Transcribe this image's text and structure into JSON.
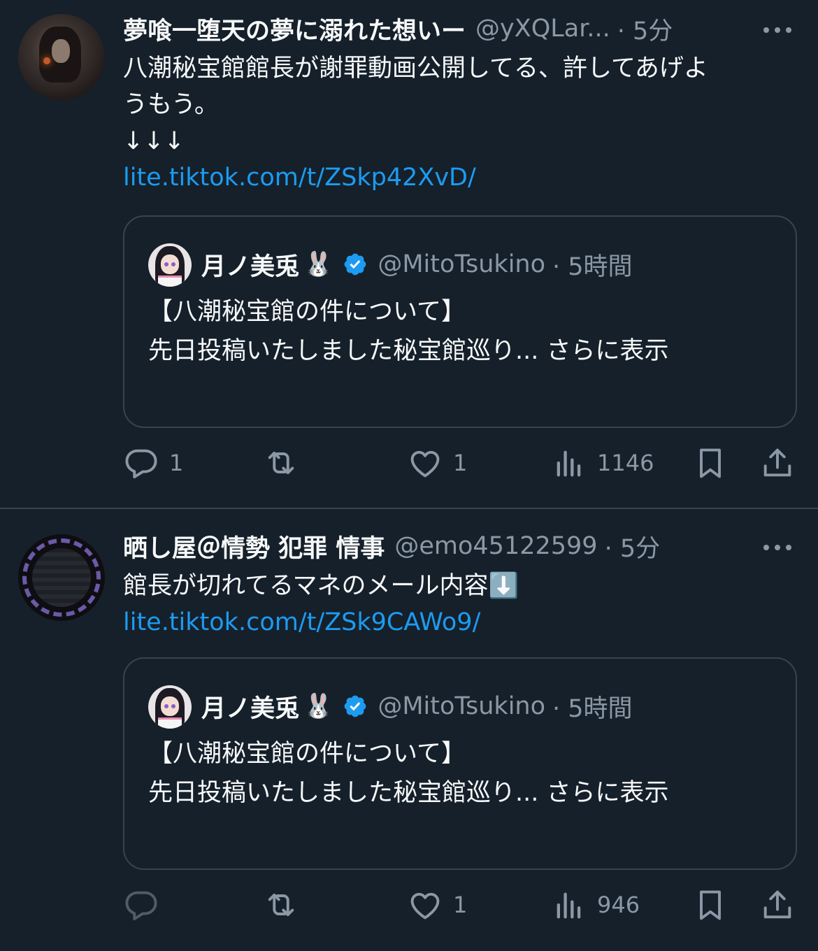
{
  "colors": {
    "background": "#15202b",
    "text": "#f7f9f9",
    "secondary": "#8b98a5",
    "link": "#1d9bf0",
    "border": "#38444d",
    "verified": "#1d9bf0"
  },
  "tweets": [
    {
      "name": "夢喰一堕天の夢に溺れた想いー",
      "handle": "@yXQLar...",
      "time": "· 5分",
      "lines": [
        "八潮秘宝館館長が謝罪動画公開してる、許してあげよ",
        "うもう。",
        "↓↓↓"
      ],
      "link": "lite.tiktok.com/t/ZSkp42XvD/",
      "quote": {
        "name": "月ノ美兎",
        "emoji": "🐰",
        "handle": "@MitoTsukino",
        "time": "· 5時間",
        "line1": "【八潮秘宝館の件について】",
        "line2": "先日投稿いたしました秘宝館巡り... さらに表示"
      },
      "actions": {
        "replies": "1",
        "retweets": "",
        "likes": "1",
        "views": "1146"
      }
    },
    {
      "name": "晒し屋＠情勢 犯罪 情事",
      "handle": "@emo45122599",
      "time": "· 5分",
      "lines": [
        "館長が切れてるマネのメール内容⬇️"
      ],
      "link": "lite.tiktok.com/t/ZSk9CAWo9/",
      "quote": {
        "name": "月ノ美兎",
        "emoji": "🐰",
        "handle": "@MitoTsukino",
        "time": "· 5時間",
        "line1": "【八潮秘宝館の件について】",
        "line2": "先日投稿いたしました秘宝館巡り... さらに表示"
      },
      "actions": {
        "replies": "",
        "retweets": "",
        "likes": "1",
        "views": "946"
      }
    }
  ]
}
